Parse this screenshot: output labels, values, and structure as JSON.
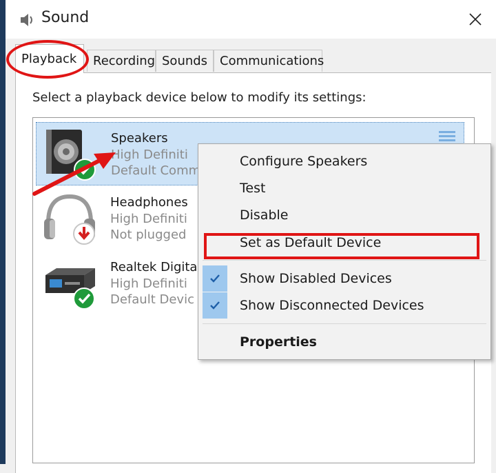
{
  "window": {
    "title": "Sound"
  },
  "tabs": [
    {
      "label": "Playback",
      "active": true
    },
    {
      "label": "Recording",
      "active": false
    },
    {
      "label": "Sounds",
      "active": false
    },
    {
      "label": "Communications",
      "active": false
    }
  ],
  "instruction": "Select a playback device below to modify its settings:",
  "devices": [
    {
      "name": "Speakers",
      "description": "High Definiti",
      "status": "Default Comm",
      "icon": "speaker-icon",
      "badge": "default-check-badge",
      "selected": true
    },
    {
      "name": "Headphones",
      "description": "High Definiti",
      "status": "Not plugged",
      "icon": "headphones-icon",
      "badge": "unplugged-arrow-badge",
      "selected": false
    },
    {
      "name": "Realtek Digita",
      "description": "High Definiti",
      "status": "Default Devic",
      "icon": "digital-output-icon",
      "badge": "default-check-badge",
      "selected": false
    }
  ],
  "context_menu": {
    "items": [
      {
        "label": "Configure Speakers",
        "checked": false
      },
      {
        "label": "Test",
        "checked": false
      },
      {
        "label": "Disable",
        "checked": false
      },
      {
        "label": "Set as Default Device",
        "checked": false
      },
      {
        "label": "Show Disabled Devices",
        "checked": true
      },
      {
        "label": "Show Disconnected Devices",
        "checked": true
      },
      {
        "label": "Properties",
        "checked": false,
        "bold": true
      }
    ]
  },
  "colors": {
    "annotation_red": "#e01515",
    "selection_blue": "#cde3f7",
    "check_blue": "#9ec8ee",
    "badge_green": "#1f9a3a"
  }
}
